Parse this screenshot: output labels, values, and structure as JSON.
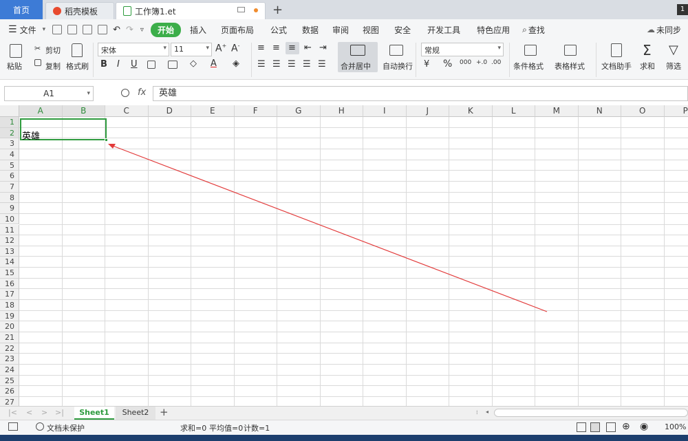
{
  "tabs": {
    "home": "首页",
    "template": "稻壳模板",
    "workbook": "工作簿1.et",
    "right_badge": "1"
  },
  "menu": {
    "file": "文件",
    "start": "开始",
    "insert": "插入",
    "page_layout": "页面布局",
    "formula": "公式",
    "data": "数据",
    "review": "审阅",
    "view": "视图",
    "security": "安全",
    "developer": "开发工具",
    "special": "特色应用",
    "search": "查找",
    "sync": "未同步"
  },
  "ribbon": {
    "paste": "粘贴",
    "cut": "剪切",
    "copy": "复制",
    "format_painter": "格式刷",
    "font_name": "宋体",
    "font_size": "11",
    "merge_center": "合并居中",
    "wrap_text": "自动换行",
    "number_format": "常规",
    "conditional_format": "条件格式",
    "table_style": "表格样式",
    "doc_helper": "文档助手",
    "sum": "求和",
    "filter": "筛选"
  },
  "formula_bar": {
    "name_box": "A1",
    "fx": "fx",
    "content": "英雄"
  },
  "grid": {
    "columns": [
      "A",
      "B",
      "C",
      "D",
      "E",
      "F",
      "G",
      "H",
      "I",
      "J",
      "K",
      "L",
      "M",
      "N",
      "O",
      "P"
    ],
    "rows": [
      "1",
      "2",
      "3",
      "4",
      "5",
      "6",
      "7",
      "8",
      "9",
      "10",
      "11",
      "12",
      "13",
      "14",
      "15",
      "16",
      "17",
      "18",
      "19",
      "20",
      "21",
      "22",
      "23",
      "24",
      "25",
      "26",
      "27"
    ],
    "cell_a1": "英雄"
  },
  "sheets": [
    "Sheet1",
    "Sheet2"
  ],
  "status": {
    "protect": "文档未保护",
    "sum": "求和=0",
    "avg": "平均值=0",
    "count": "计数=1",
    "zoom": "100%"
  },
  "colors": {
    "accent_green": "#2e9b3e",
    "home_blue": "#3d7bd6",
    "arrow_red": "#e23a3a"
  }
}
